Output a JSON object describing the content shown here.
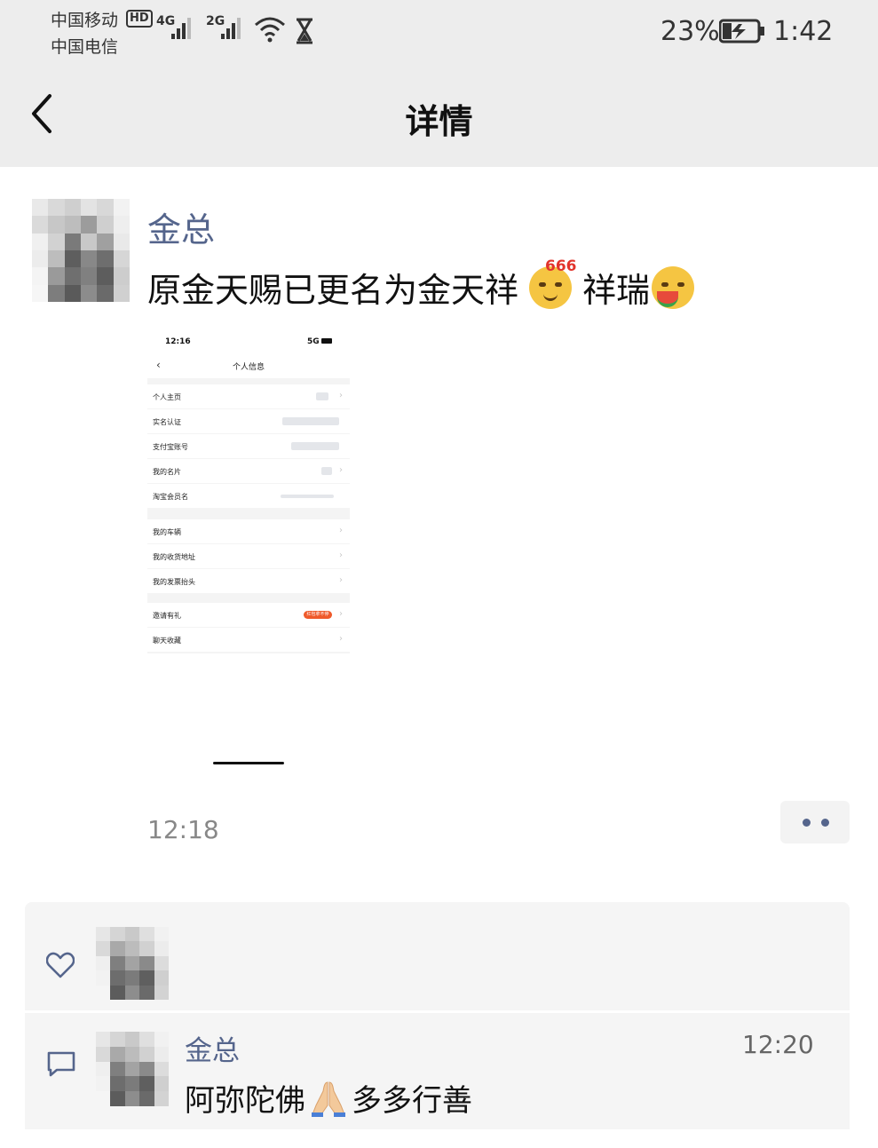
{
  "status_bar": {
    "carrier_primary": "中国移动",
    "hd_label": "HD",
    "carrier_secondary": "中国电信",
    "signal1_label": "4G",
    "signal2_label": "2G",
    "battery_percent": "23%",
    "time": "1:42"
  },
  "header": {
    "title": "详情",
    "back_icon": "chevron-left-icon"
  },
  "post": {
    "author": "金总",
    "text_part1": "原金天赐已更名为金天祥",
    "emoji1": "666-face-emoji",
    "emoji1_label": "666",
    "text_part2": "祥瑞",
    "emoji2": "watermelon-face-emoji",
    "time": "12:18",
    "more_icon": "more-dots-icon",
    "image": {
      "status_time": "12:16",
      "status_net": "5G",
      "nav_title": "个人信息",
      "rows_group1": [
        "个人主页",
        "实名认证",
        "支付宝账号",
        "我的名片",
        "淘宝会员名"
      ],
      "rows_group2": [
        "我的车辆",
        "我的收货地址",
        "我的发票抬头"
      ],
      "rows_group3": [
        "邀请有礼",
        "聊天收藏"
      ],
      "invite_badge": "红包拿不停"
    }
  },
  "likes": {
    "icon": "heart-icon"
  },
  "comments": [
    {
      "icon": "comment-icon",
      "author": "金总",
      "time": "12:20",
      "text_part1": "阿弥陀佛",
      "emoji": "folded-hands-emoji",
      "text_part2": "多多行善"
    }
  ],
  "colors": {
    "name_blue": "#55658c",
    "header_bg": "#ededed",
    "panel_bg": "#f5f5f5"
  }
}
